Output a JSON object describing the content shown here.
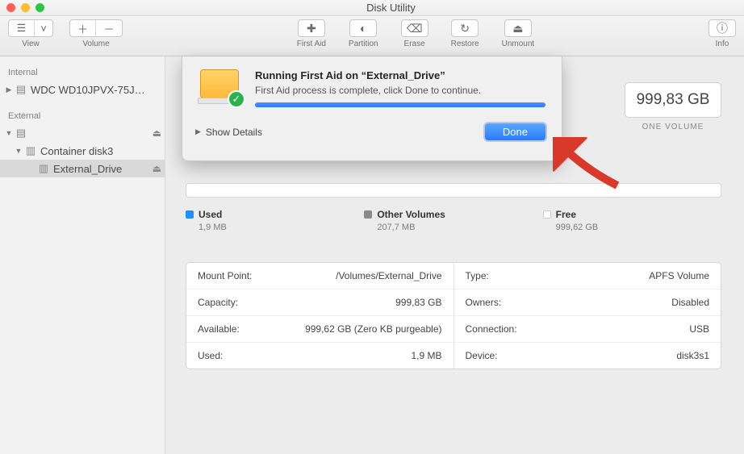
{
  "window": {
    "title": "Disk Utility"
  },
  "toolbar": {
    "view": "View",
    "volume": "Volume",
    "first_aid": "First Aid",
    "partition": "Partition",
    "erase": "Erase",
    "restore": "Restore",
    "unmount": "Unmount",
    "info": "Info"
  },
  "sidebar": {
    "sections": [
      {
        "heading": "Internal",
        "items": [
          {
            "label": "WDC WD10JPVX-75J…",
            "expandable": true
          }
        ]
      },
      {
        "heading": "External",
        "items": [
          {
            "label": " ",
            "ejectable": true,
            "expandable": true,
            "children": [
              {
                "label": "Container disk3",
                "expandable": true,
                "children": [
                  {
                    "label": "External_Drive",
                    "ejectable": true,
                    "selected": true
                  }
                ]
              }
            ]
          }
        ]
      }
    ]
  },
  "capacity": {
    "value": "999,83 GB",
    "sub": "ONE VOLUME"
  },
  "usage": {
    "used": {
      "label": "Used",
      "value": "1,9 MB"
    },
    "other": {
      "label": "Other Volumes",
      "value": "207,7 MB"
    },
    "free": {
      "label": "Free",
      "value": "999,62 GB"
    }
  },
  "details": {
    "left": [
      {
        "k": "Mount Point:",
        "v": "/Volumes/External_Drive"
      },
      {
        "k": "Capacity:",
        "v": "999,83 GB"
      },
      {
        "k": "Available:",
        "v": "999,62 GB (Zero KB purgeable)"
      },
      {
        "k": "Used:",
        "v": "1,9 MB"
      }
    ],
    "right": [
      {
        "k": "Type:",
        "v": "APFS Volume"
      },
      {
        "k": "Owners:",
        "v": "Disabled"
      },
      {
        "k": "Connection:",
        "v": "USB"
      },
      {
        "k": "Device:",
        "v": "disk3s1"
      }
    ]
  },
  "dialog": {
    "title": "Running First Aid on “External_Drive”",
    "message": "First Aid process is complete, click Done to continue.",
    "show_details": "Show Details",
    "done": "Done"
  }
}
